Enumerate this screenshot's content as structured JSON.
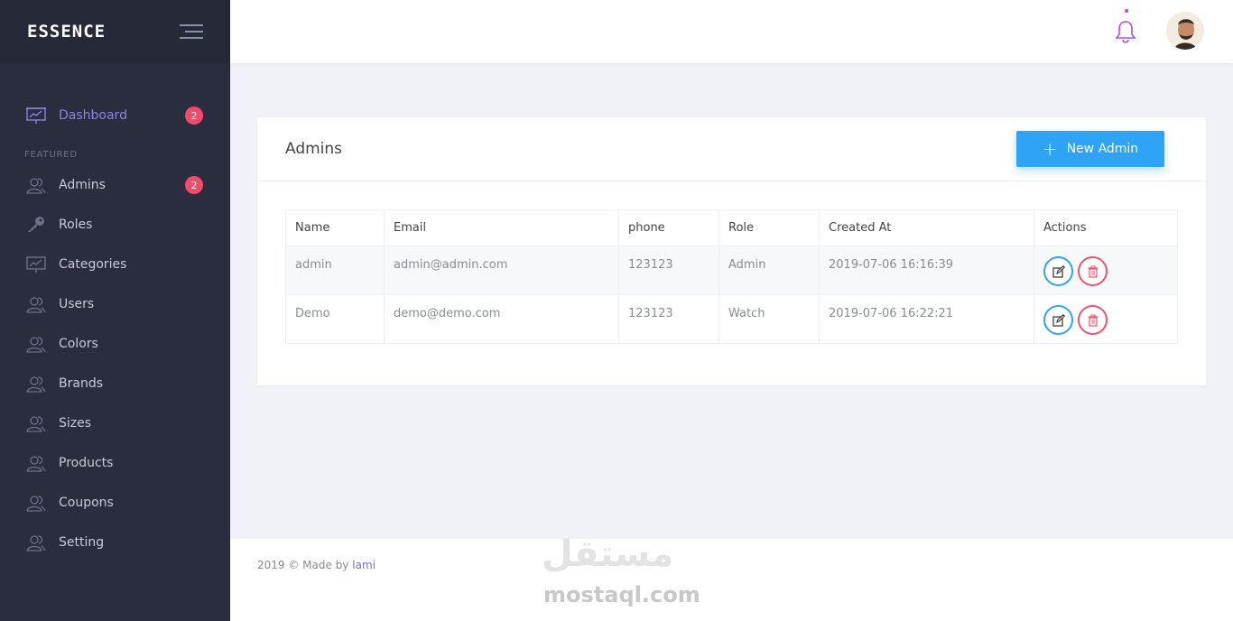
{
  "brand": "ESSENCE",
  "sidebar": {
    "items": [
      {
        "label": "Dashboard",
        "badge": "2",
        "icon": "presentation-chart-icon",
        "active": true
      },
      {
        "label": "Admins",
        "badge": "2",
        "icon": "users-icon"
      },
      {
        "label": "Roles",
        "icon": "key-icon"
      },
      {
        "label": "Categories",
        "icon": "presentation-chart-icon"
      },
      {
        "label": "Users",
        "icon": "users-icon"
      },
      {
        "label": "Colors",
        "icon": "users-icon"
      },
      {
        "label": "Brands",
        "icon": "users-icon"
      },
      {
        "label": "Sizes",
        "icon": "users-icon"
      },
      {
        "label": "Products",
        "icon": "users-icon"
      },
      {
        "label": "Coupons",
        "icon": "users-icon"
      },
      {
        "label": "Setting",
        "icon": "users-icon"
      }
    ],
    "section_label": "FEATURED"
  },
  "main": {
    "card_title": "Admins",
    "new_button_label": "New Admin",
    "table": {
      "columns": [
        "Name",
        "Email",
        "phone",
        "Role",
        "Created At",
        "Actions"
      ],
      "rows": [
        {
          "name": "admin",
          "email": "admin@admin.com",
          "phone": "123123",
          "role": "Admin",
          "created_at": "2019-07-06 16:16:39"
        },
        {
          "name": "Demo",
          "email": "demo@demo.com",
          "phone": "123123",
          "role": "Watch",
          "created_at": "2019-07-06 16:22:21"
        }
      ]
    }
  },
  "footer": {
    "prefix": "2019 © Made by",
    "author": "lami"
  },
  "watermark": {
    "arabic": "مستقل",
    "latin": "mostaql.com"
  },
  "colors": {
    "sidebar_bg": "#2a2d3e",
    "accent": "#2fa3f5",
    "badge": "#f44a6a",
    "active_menu": "#8c82e4",
    "delete": "#f0506e"
  }
}
